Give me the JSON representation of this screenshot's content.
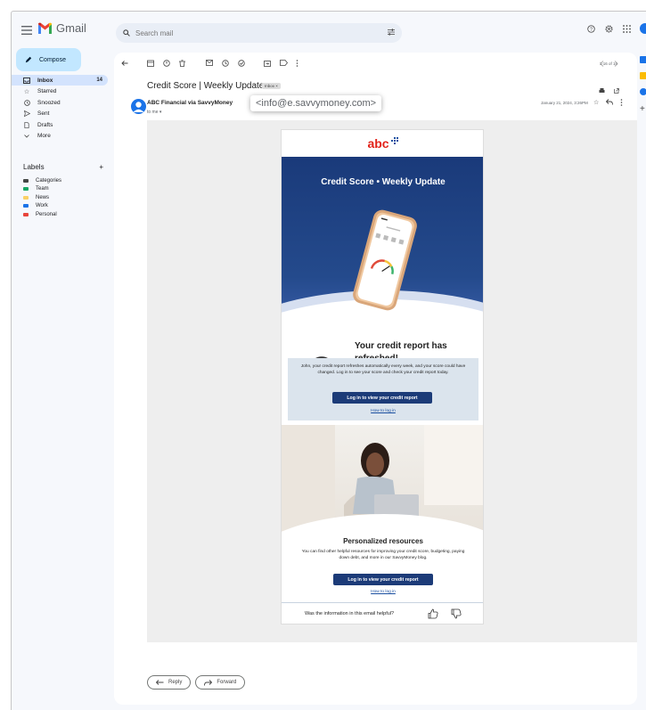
{
  "app": {
    "name": "Gmail"
  },
  "search": {
    "placeholder": "Search mail"
  },
  "compose": {
    "label": "Compose"
  },
  "nav": [
    {
      "label": "Inbox",
      "count": "14",
      "icon": "inbox-icon",
      "active": true
    },
    {
      "label": "Starred",
      "icon": "star-icon"
    },
    {
      "label": "Snoozed",
      "icon": "clock-icon"
    },
    {
      "label": "Sent",
      "icon": "send-icon"
    },
    {
      "label": "Drafts",
      "icon": "draft-icon"
    },
    {
      "label": "More",
      "icon": "chevron-down-icon"
    }
  ],
  "labels": {
    "heading": "Labels",
    "add": "+",
    "items": [
      {
        "label": "Categories",
        "color": "#444746"
      },
      {
        "label": "Team",
        "color": "#16a765"
      },
      {
        "label": "News",
        "color": "#fad165"
      },
      {
        "label": "Work",
        "color": "#1a73e8"
      },
      {
        "label": "Personal",
        "color": "#e8453c"
      }
    ]
  },
  "toolbar": {
    "pager": "1-16 of 16"
  },
  "message": {
    "subject": "Credit Score | Weekly Update",
    "chip": "Inbox ×",
    "sender": "ABC Financial via SavvyMoney",
    "email": "<info@e.savvymoney.com>",
    "to": "to me ▾",
    "date": "January 21, 2024, 3:26PM"
  },
  "newsletter": {
    "brand": "abc",
    "hero_title": "Credit Score • Weekly Update",
    "refresh_title": "Your credit report has refreshed!",
    "body": "John, your credit report refreshes automatically every week, and your score could have changed. Log in to see your score and check your credit report today.",
    "cta1": "Log in to view your credit report",
    "howto1": "How to log in",
    "res_title": "Personalized resources",
    "res_text": "You can find other helpful resources for improving your credit score, budgeting, paying down debt, and more in our SavvyMoney blog.",
    "cta2": "Log in to view your credit report",
    "howto2": "How to log in",
    "helpful": "Was the information in this email helpful?"
  },
  "actions": {
    "reply": "Reply",
    "forward": "Forward"
  }
}
